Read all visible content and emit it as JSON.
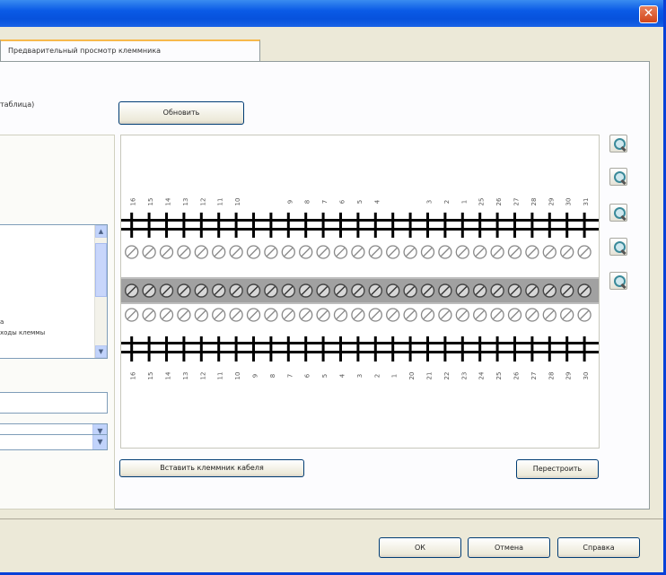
{
  "window": {
    "close_glyph": "✕",
    "tab_label": "Предварительный просмотр клеммника"
  },
  "left": {
    "label_fragment": "таблица)",
    "list_lines": [
      "а",
      "ходы клеммы"
    ],
    "scroll_up": "▲",
    "scroll_down": "▼",
    "combo_arrow": "▼"
  },
  "preview": {
    "refresh_label": "Обновить",
    "insert_label": "Вставить клеммник кабеля",
    "rebuild_label": "Перестроить",
    "top_labels": [
      "16",
      "15",
      "14",
      "13",
      "12",
      "11",
      "10",
      "",
      "",
      "9",
      "8",
      "7",
      "6",
      "5",
      "4",
      "",
      "",
      "3",
      "2",
      "1",
      "25",
      "26",
      "27",
      "28",
      "29",
      "30",
      "31"
    ],
    "bottom_labels": [
      "16",
      "15",
      "14",
      "13",
      "12",
      "11",
      "10",
      "9",
      "8",
      "7",
      "6",
      "5",
      "4",
      "3",
      "2",
      "1",
      "20",
      "21",
      "22",
      "23",
      "24",
      "25",
      "26",
      "27",
      "28",
      "29",
      "30"
    ],
    "colors": {
      "frame": "#000000",
      "gray": "#888888",
      "background": "#ffffff"
    }
  },
  "zoom_tools": [
    {
      "name": "zoom-in-icon"
    },
    {
      "name": "zoom-out-icon"
    },
    {
      "name": "zoom-window-icon"
    },
    {
      "name": "zoom-fit-icon"
    },
    {
      "name": "zoom-all-icon"
    }
  ],
  "footer": {
    "ok_label": "ОК",
    "cancel_label": "Отмена",
    "help_label": "Справка"
  }
}
